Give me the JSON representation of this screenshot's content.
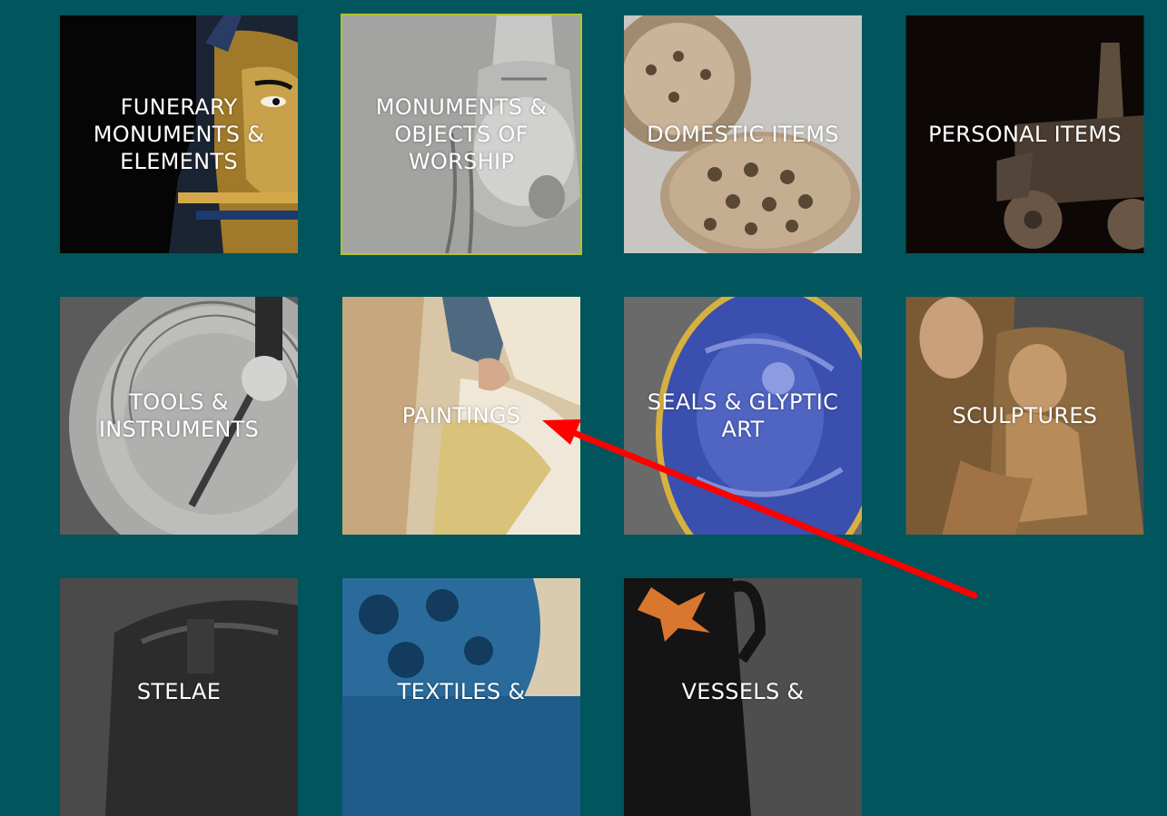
{
  "categories": [
    {
      "label": "FUNERARY MONUMENTS & ELEMENTS",
      "icon": "funerary-mask-image"
    },
    {
      "label": "MONUMENTS & OBJECTS OF WORSHIP",
      "icon": "censer-image"
    },
    {
      "label": "DOMESTIC ITEMS",
      "icon": "pottery-image"
    },
    {
      "label": "PERSONAL ITEMS",
      "icon": "toy-horse-image"
    },
    {
      "label": "TOOLS & INSTRUMENTS",
      "icon": "sundial-image"
    },
    {
      "label": "PAINTINGS",
      "icon": "painting-image"
    },
    {
      "label": "SEALS & GLYPTIC ART",
      "icon": "lapis-seal-image"
    },
    {
      "label": "SCULPTURES",
      "icon": "madonna-sculpture-image"
    },
    {
      "label": "STELAE",
      "icon": "stele-image"
    },
    {
      "label": "TEXTILES &",
      "icon": "textile-image"
    },
    {
      "label": "VESSELS &",
      "icon": "vase-image"
    }
  ],
  "colors": {
    "background": "#01555c",
    "highlight_border": "#b5c22c",
    "annotation_arrow": "#ff0000"
  }
}
